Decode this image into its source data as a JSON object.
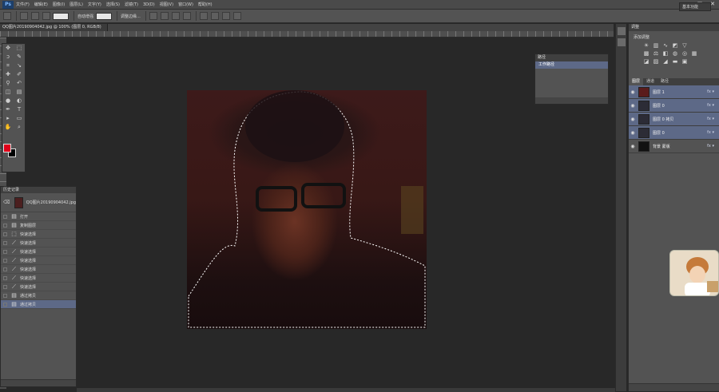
{
  "app": {
    "logo": "Ps",
    "menus": [
      "文件(F)",
      "编辑(E)",
      "图像(I)",
      "图层(L)",
      "文字(Y)",
      "选择(S)",
      "滤镜(T)",
      "3D(D)",
      "视图(V)",
      "窗口(W)",
      "帮助(H)"
    ]
  },
  "options": {
    "auto_enhance": "自动增强",
    "refine_label": "调整边缘...",
    "workspace": "基本功能"
  },
  "document": {
    "tab_title": "QQ图片20190904042.jpg @ 100% (图层 0, RGB/8)"
  },
  "history": {
    "panel_title": "历史记录",
    "snapshot_label": "QQ图片20190904042.jpg",
    "items": [
      {
        "label": "打开",
        "icon": "doc"
      },
      {
        "label": "复制图层",
        "icon": "doc"
      },
      {
        "label": "快速选择",
        "icon": "select"
      },
      {
        "label": "快速选择",
        "icon": "brush"
      },
      {
        "label": "快速选择",
        "icon": "brush"
      },
      {
        "label": "快速选择",
        "icon": "brush"
      },
      {
        "label": "快速选择",
        "icon": "brush"
      },
      {
        "label": "快速选择",
        "icon": "brush"
      },
      {
        "label": "快速选择",
        "icon": "brush"
      },
      {
        "label": "通过拷贝",
        "icon": "doc"
      },
      {
        "label": "通过拷贝",
        "icon": "doc",
        "active": true
      }
    ]
  },
  "paths": {
    "panel_title": "路径",
    "row_label": "工作路径"
  },
  "adjustments": {
    "header": "调整",
    "title": "添加调整"
  },
  "layers": {
    "tabs": [
      "图层",
      "通道",
      "路径"
    ],
    "rows": [
      {
        "name": "图层 1",
        "opt": "fx ▾",
        "thumb": "#5a1c1c",
        "selected": true
      },
      {
        "name": "图层 0",
        "opt": "fx ▾",
        "thumb": "#2c2c36",
        "selected": true
      },
      {
        "name": "图层 0 拷贝",
        "opt": "fx ▾",
        "thumb": "#2c2c36",
        "selected": true
      },
      {
        "name": "图层 0",
        "opt": "fx ▾",
        "thumb": "#2c2c36",
        "selected": true
      },
      {
        "name": "背景 蒙版",
        "opt": "fx ▾",
        "thumb": "#111111",
        "selected": false
      }
    ]
  }
}
